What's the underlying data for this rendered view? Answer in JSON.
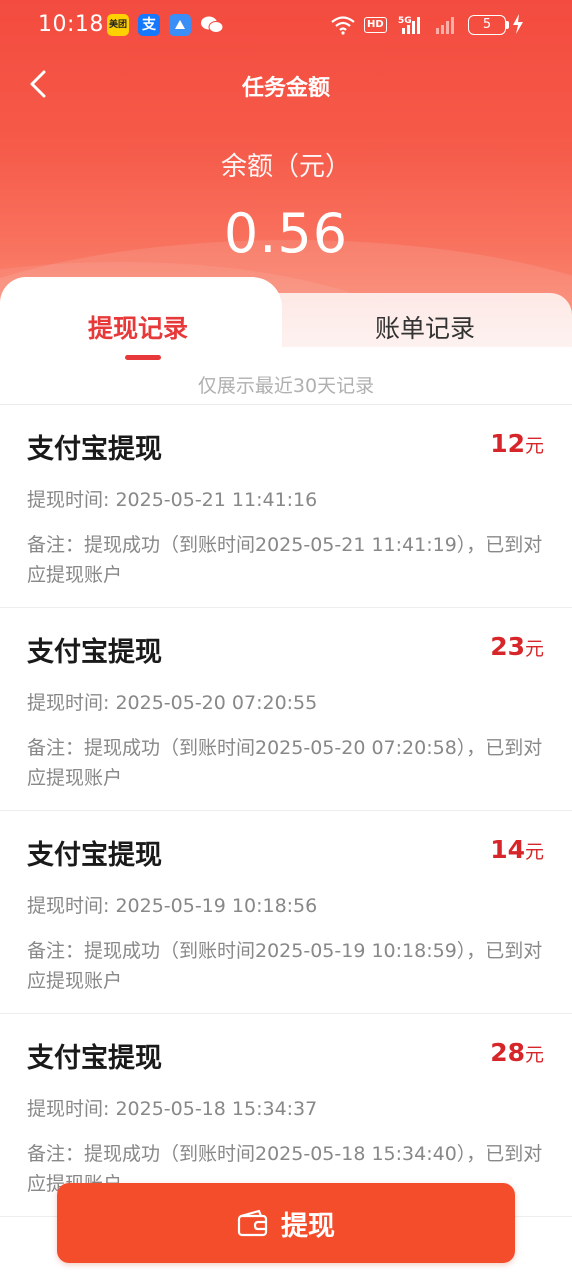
{
  "status_bar": {
    "time": "10:18",
    "apps": [
      "美团",
      "支",
      "",
      "微信"
    ],
    "hd_label": "HD",
    "network": "5G",
    "battery": "5"
  },
  "header": {
    "title": "任务金额",
    "balance_label": "余额（元）",
    "balance_value": "0.56"
  },
  "tabs": [
    {
      "label": "提现记录",
      "active": true
    },
    {
      "label": "账单记录",
      "active": false
    }
  ],
  "hint": "仅展示最近30天记录",
  "records": [
    {
      "title": "支付宝提现",
      "amount": "12",
      "unit": "元",
      "time": "提现时间: 2025-05-21 11:41:16",
      "note": "备注：提现成功（到账时间2025-05-21 11:41:19），已到对应提现账户"
    },
    {
      "title": "支付宝提现",
      "amount": "23",
      "unit": "元",
      "time": "提现时间: 2025-05-20 07:20:55",
      "note": "备注：提现成功（到账时间2025-05-20 07:20:58），已到对应提现账户"
    },
    {
      "title": "支付宝提现",
      "amount": "14",
      "unit": "元",
      "time": "提现时间: 2025-05-19 10:18:56",
      "note": "备注：提现成功（到账时间2025-05-19 10:18:59），已到对应提现账户"
    },
    {
      "title": "支付宝提现",
      "amount": "28",
      "unit": "元",
      "time": "提现时间: 2025-05-18 15:34:37",
      "note": "备注：提现成功（到账时间2025-05-18 15:34:40），已到对应提现账户"
    }
  ],
  "withdraw_button": {
    "label": "提现",
    "icon": "wallet-icon"
  },
  "colors": {
    "header_red": "#f34b3f",
    "accent_red": "#e8393a",
    "amount_red": "#d7262a",
    "button_red": "#f34d2c"
  }
}
